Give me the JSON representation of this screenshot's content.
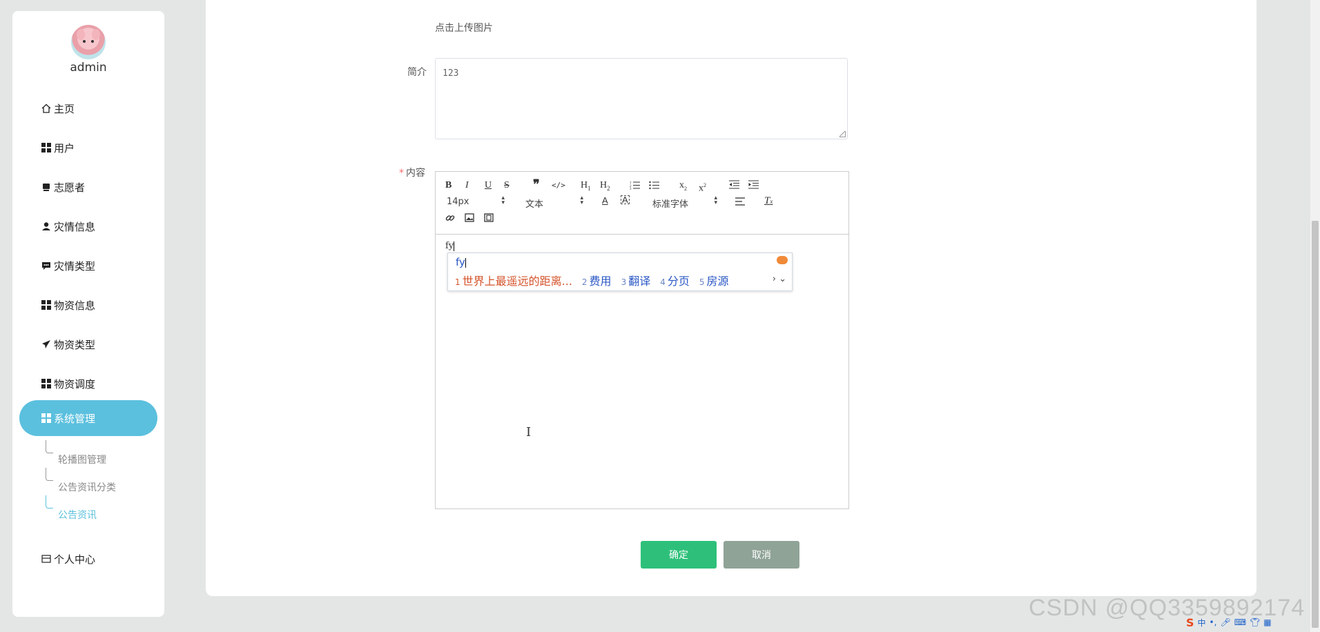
{
  "sidebar": {
    "username": "admin",
    "items": [
      {
        "label": "主页",
        "icon": "home-icon"
      },
      {
        "label": "用户",
        "icon": "grid-icon"
      },
      {
        "label": "志愿者",
        "icon": "volunteer-icon"
      },
      {
        "label": "灾情信息",
        "icon": "user-icon"
      },
      {
        "label": "灾情类型",
        "icon": "comment-icon"
      },
      {
        "label": "物资信息",
        "icon": "grid-icon"
      },
      {
        "label": "物资类型",
        "icon": "paper-plane-icon"
      },
      {
        "label": "物资调度",
        "icon": "grid-icon"
      }
    ],
    "active": {
      "label": "系统管理",
      "icon": "grid-icon"
    },
    "sub_items": [
      {
        "label": "轮播图管理"
      },
      {
        "label": "公告资讯分类"
      },
      {
        "label": "公告资讯",
        "active": true
      }
    ],
    "personal": {
      "label": "个人中心",
      "icon": "card-icon"
    }
  },
  "form": {
    "upload_hint": "点击上传图片",
    "intro_label": "简介",
    "intro_value": "123",
    "content_required": "*",
    "content_label": "内容",
    "editor": {
      "font_size": "14px",
      "header_select": "文本",
      "font_family": "标准字体",
      "body_text": "fy"
    },
    "confirm_label": "确定",
    "cancel_label": "取消"
  },
  "ime": {
    "input": "fy",
    "candidates": [
      {
        "n": "1",
        "text": "世界上最遥远的距离..."
      },
      {
        "n": "2",
        "text": "费用"
      },
      {
        "n": "3",
        "text": "翻译"
      },
      {
        "n": "4",
        "text": "分页"
      },
      {
        "n": "5",
        "text": "房源"
      }
    ]
  },
  "watermark": "CSDN @QQ3359892174",
  "tray": {
    "lang": "中"
  },
  "colors": {
    "active_menu": "#5bc0de",
    "confirm": "#2ec07a",
    "cancel": "#8fa397",
    "required": "#f56c6c",
    "ime_first": "#d4532a",
    "ime_text": "#2a57c5"
  }
}
